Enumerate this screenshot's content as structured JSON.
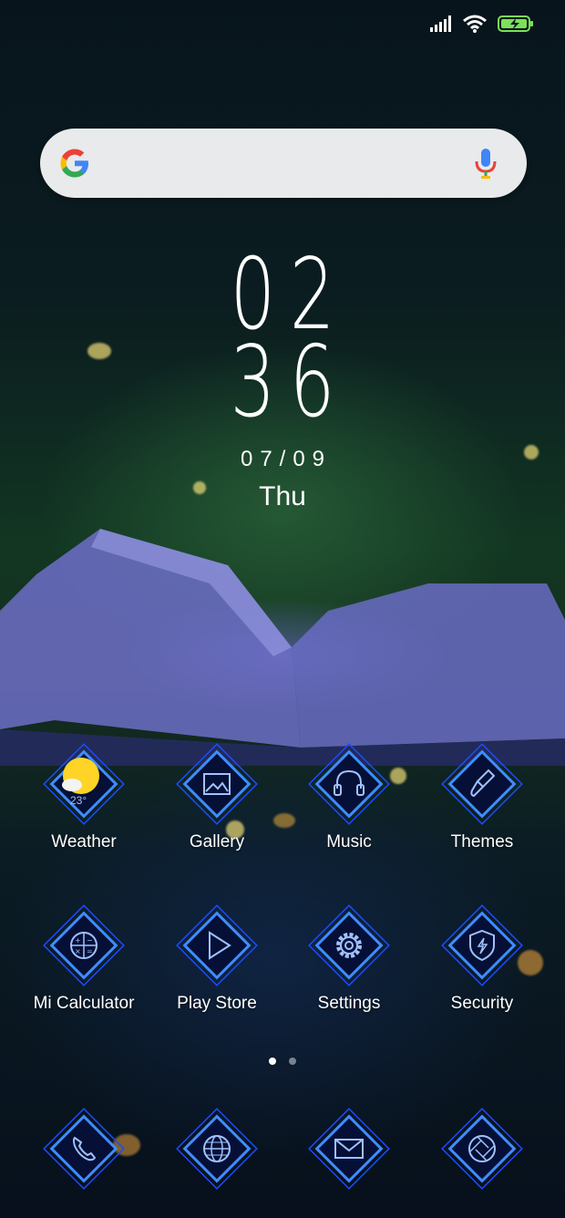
{
  "colors": {
    "neon": "#3f8cff",
    "neon_glow": "#1b4cff",
    "search_bg": "#e8eaec",
    "battery": "#7be05a"
  },
  "status": {
    "icons": [
      "signal-icon",
      "wifi-icon",
      "battery-charging-icon"
    ]
  },
  "search": {
    "placeholder": ""
  },
  "clock": {
    "hours": "02",
    "minutes": "36",
    "date": "07/09",
    "day": "Thu"
  },
  "apps_row1": [
    {
      "label": "Weather",
      "icon": "weather-icon",
      "temp": "23°"
    },
    {
      "label": "Gallery",
      "icon": "gallery-icon"
    },
    {
      "label": "Music",
      "icon": "headphones-icon"
    },
    {
      "label": "Themes",
      "icon": "paintbrush-icon"
    }
  ],
  "apps_row2": [
    {
      "label": "Mi Calculator",
      "icon": "calculator-icon"
    },
    {
      "label": "Play Store",
      "icon": "play-store-icon"
    },
    {
      "label": "Settings",
      "icon": "gear-icon"
    },
    {
      "label": "Security",
      "icon": "shield-icon"
    }
  ],
  "dock": [
    {
      "icon": "phone-icon"
    },
    {
      "icon": "browser-globe-icon"
    },
    {
      "icon": "messages-envelope-icon"
    },
    {
      "icon": "camera-shutter-icon"
    }
  ],
  "pages": {
    "count": 2,
    "active": 1
  }
}
